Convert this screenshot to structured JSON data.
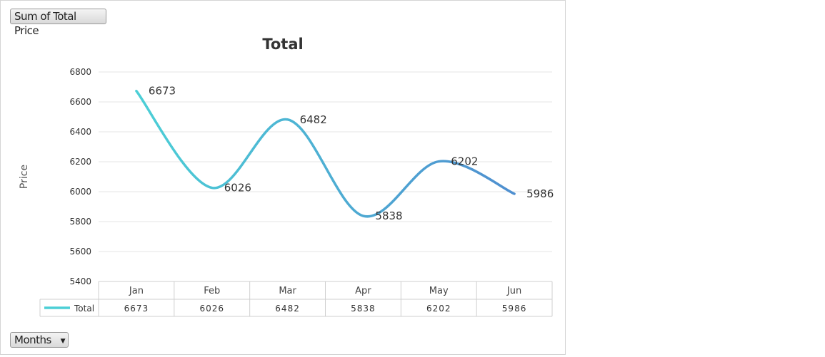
{
  "filters": {
    "value_field": "Sum of Total Price",
    "axis_field": "Months"
  },
  "colors": {
    "line_start": "#4ccfd6",
    "line_end": "#4f8fd0",
    "grid": "#e6e6e6",
    "table_border": "#cfcfcf"
  },
  "chart_data": {
    "type": "line",
    "title": "Total",
    "xlabel": "",
    "ylabel": "Price",
    "categories": [
      "Jan",
      "Feb",
      "Mar",
      "Apr",
      "May",
      "Jun"
    ],
    "series": [
      {
        "name": "Total",
        "values": [
          6673,
          6026,
          6482,
          5838,
          6202,
          5986
        ]
      }
    ],
    "data_labels": [
      "6673",
      "6026",
      "6482",
      "5838",
      "6202",
      "5986"
    ],
    "table_values": [
      "6673",
      "6026",
      "6482",
      "5838",
      "6202",
      "5986"
    ],
    "ylim": [
      5400,
      6800
    ],
    "yticks": [
      "5400",
      "5600",
      "5800",
      "6000",
      "6200",
      "6400",
      "6600",
      "6800"
    ],
    "smooth": true,
    "grid": true,
    "legend": "data-table"
  }
}
